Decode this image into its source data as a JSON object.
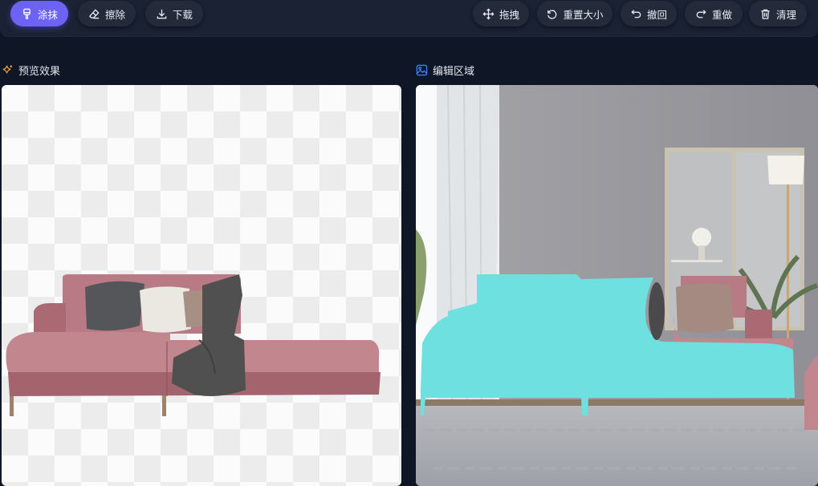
{
  "toolbar": {
    "paint_label": "涂抹",
    "erase_label": "擦除",
    "download_label": "下载",
    "drag_label": "拖拽",
    "reset_size_label": "重置大小",
    "undo_label": "撤回",
    "redo_label": "重做",
    "clear_label": "清理"
  },
  "sections": {
    "preview_title": "预览效果",
    "editor_title": "编辑区域"
  },
  "colors": {
    "accent": "#6c63f5",
    "mask": "#6ee0e0",
    "sofa": "#b87a84"
  }
}
